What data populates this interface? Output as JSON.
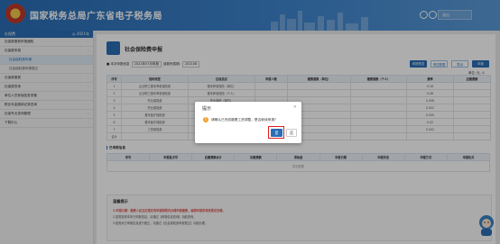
{
  "header": {
    "site_title": "国家税务总局广东省电子税务局",
    "user_box": "退出"
  },
  "sidebar": {
    "head_label": "社保费",
    "head_right": "◎ 2021年",
    "items": [
      {
        "label": "社保费缴费申报通知",
        "sub": false,
        "active": false
      },
      {
        "label": "社保费申报",
        "sub": false,
        "active": false
      },
      {
        "label": "社会保险费申报",
        "sub": true,
        "active": true
      },
      {
        "label": "社会保险费申报更正",
        "sub": true,
        "active": false
      },
      {
        "label": "社保费缴费",
        "sub": false,
        "active": false
      },
      {
        "label": "社保费查询",
        "sub": false,
        "active": false
      },
      {
        "label": "单位人员参保信息采集",
        "sub": false,
        "active": false
      },
      {
        "label": "职业年金缴纳记录查询",
        "sub": false,
        "active": false
      },
      {
        "label": "社保专业查询管理",
        "sub": false,
        "active": false
      },
      {
        "label": "下载中心",
        "sub": false,
        "active": false
      }
    ]
  },
  "page": {
    "title": "社会保险费申报",
    "filter_label": "■ 本次申报信息",
    "period_select": "2021年07月申报",
    "period_label": "费款所属期:",
    "period_value": "202106",
    "buttons": {
      "declare": "申报预览",
      "reset": "清空数据",
      "export": "导出",
      "save": "申报"
    },
    "unit_note": "单位: 元, 人"
  },
  "main_table": {
    "headers": [
      "序号",
      "险种类型",
      "征收品目",
      "申报人数",
      "缴费基数（单位）",
      "缴费基数（个人）",
      "费率",
      "应缴费额"
    ],
    "rows": [
      [
        "1",
        "企业职工基本养老保险费",
        "基本养老保险（单位）",
        "",
        "",
        "",
        "0.16",
        ""
      ],
      [
        "2",
        "企业职工基本养老保险费",
        "基本养老保险（个人）",
        "",
        "",
        "",
        "0.08",
        ""
      ],
      [
        "3",
        "失业保险费",
        "失业保险（单位）",
        "",
        "",
        "",
        "0.008",
        ""
      ],
      [
        "4",
        "失业保险费",
        "失业保险（个人）",
        "",
        "",
        "",
        "0.002",
        ""
      ],
      [
        "5",
        "基本医疗保险费",
        "基本医疗（单位）",
        "",
        "",
        "",
        "0.055",
        ""
      ],
      [
        "6",
        "基本医疗保险费",
        "基本医疗（个人）",
        "",
        "",
        "",
        "0.02",
        ""
      ],
      [
        "7",
        "工伤保险费",
        "工伤保险",
        "",
        "",
        "",
        "0.002",
        ""
      ],
      [
        "合计",
        "",
        "",
        "",
        "",
        "",
        "",
        ""
      ]
    ]
  },
  "sub_section": {
    "title": "已申报信息",
    "headers": [
      "序号",
      "申报批次号",
      "应缴费额合计",
      "实缴费额",
      "滞纳金",
      "申报日期",
      "申报状态",
      "申报方式",
      "申报机关"
    ],
    "empty_text": "暂无数据"
  },
  "tips": {
    "title": "温馨提示",
    "lines": [
      "1.申报日期：缴费人应当在规定的申报期限内办理申报缴费，逾期申报的将按规定处理。",
      "2.如需查看本年已申报信息，请通过【申报信息查询】功能查询。",
      "3.如需对已申报信息进行更正，请通过【社会保险费申报更正】功能办理。"
    ]
  },
  "dialog": {
    "title": "提示",
    "close": "×",
    "warn_icon": "!",
    "message": "请确认已完成缴费工资调整，是否继续申报？",
    "ok": "是",
    "no": "否"
  }
}
